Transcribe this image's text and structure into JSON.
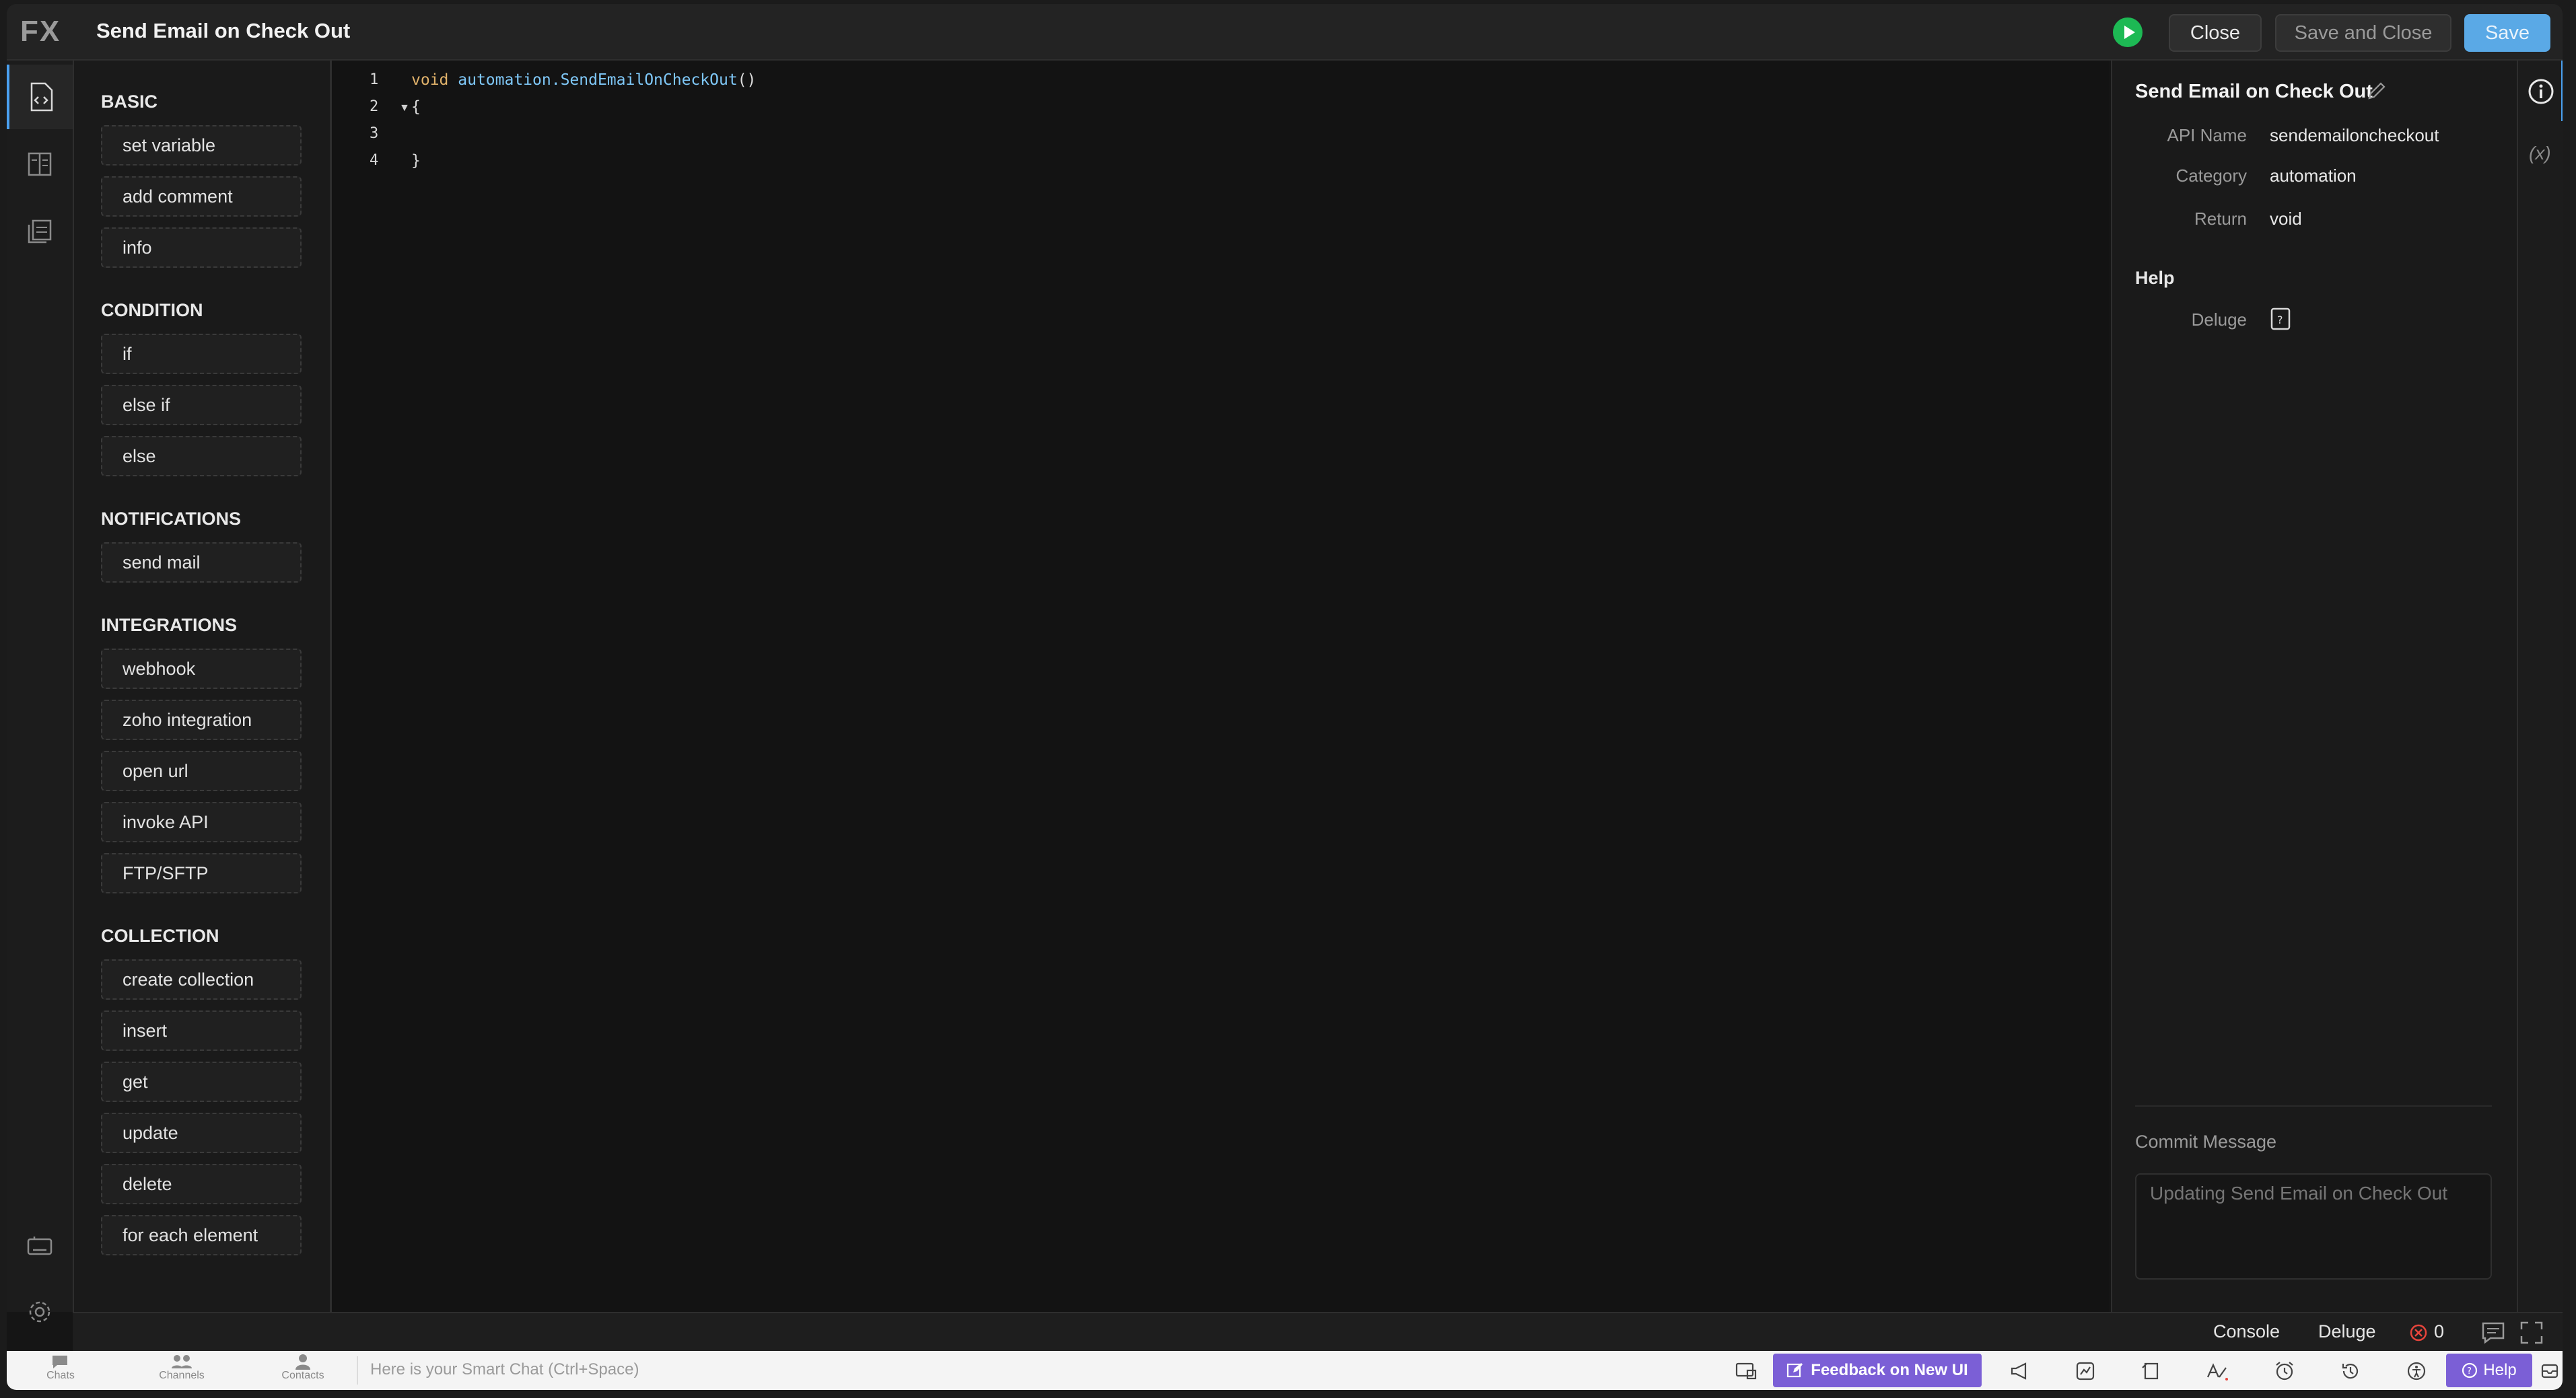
{
  "header": {
    "logo": "FX",
    "title": "Send Email on Check Out",
    "close_label": "Close",
    "save_close_label": "Save and Close",
    "save_label": "Save"
  },
  "rail": {
    "items": [
      "code-editor-icon",
      "schema-icon",
      "pages-icon"
    ],
    "bottom": [
      "keyboard-icon",
      "settings-icon"
    ]
  },
  "palette": {
    "sections": [
      {
        "title": "BASIC",
        "items": [
          "set variable",
          "add comment",
          "info"
        ]
      },
      {
        "title": "CONDITION",
        "items": [
          "if",
          "else if",
          "else"
        ]
      },
      {
        "title": "NOTIFICATIONS",
        "items": [
          "send mail"
        ]
      },
      {
        "title": "INTEGRATIONS",
        "items": [
          "webhook",
          "zoho integration",
          "open url",
          "invoke API",
          "FTP/SFTP"
        ]
      },
      {
        "title": "COLLECTION",
        "items": [
          "create collection",
          "insert",
          "get",
          "update",
          "delete",
          "for each element"
        ]
      }
    ]
  },
  "editor": {
    "line_numbers": [
      "1",
      "2",
      "3",
      "4"
    ],
    "line1_kw": "void",
    "line1_fn": "automation.SendEmailOnCheckOut",
    "line1_tail": "()",
    "line2": "{",
    "line3": "",
    "line4": "}"
  },
  "properties": {
    "title": "Send Email on Check Out",
    "api_name_label": "API Name",
    "api_name_value": "sendemailoncheckout",
    "category_label": "Category",
    "category_value": "automation",
    "return_label": "Return",
    "return_value": "void",
    "help_heading": "Help",
    "deluge_label": "Deluge",
    "commit_label": "Commit Message",
    "commit_placeholder": "Updating Send Email on Check Out"
  },
  "right_rail": {
    "items": [
      "info-icon",
      "variable-icon"
    ]
  },
  "statusbar": {
    "console": "Console",
    "deluge": "Deluge",
    "error_count": "0"
  },
  "appbar": {
    "tabs": [
      "Chats",
      "Channels",
      "Contacts"
    ],
    "smart_chat_placeholder": "Here is your Smart Chat (Ctrl+Space)",
    "feedback_label": "Feedback on New UI",
    "help_label": "Help"
  }
}
